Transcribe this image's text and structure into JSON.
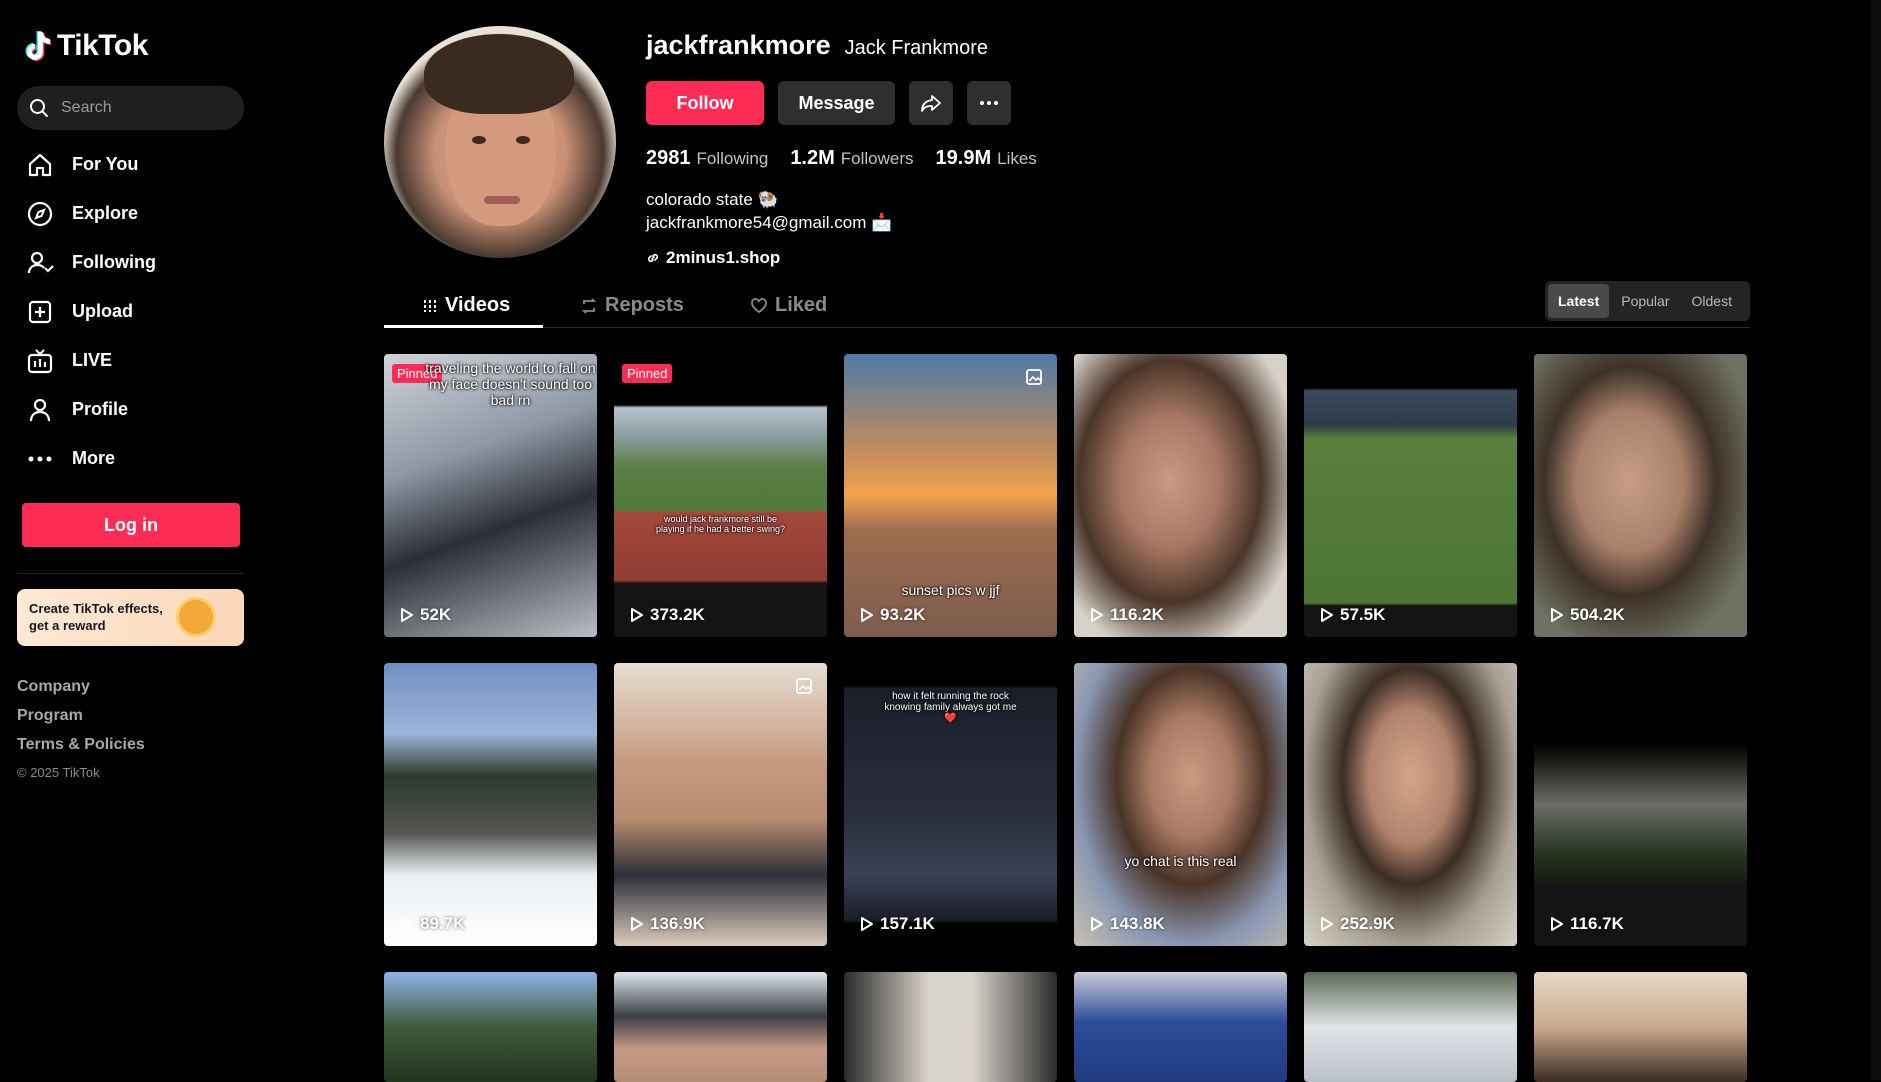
{
  "sidebar": {
    "logo": "TikTok",
    "search_placeholder": "Search",
    "nav": [
      {
        "label": "For You",
        "icon": "home-icon"
      },
      {
        "label": "Explore",
        "icon": "compass-icon"
      },
      {
        "label": "Following",
        "icon": "following-icon"
      },
      {
        "label": "Upload",
        "icon": "upload-icon"
      },
      {
        "label": "LIVE",
        "icon": "live-icon"
      },
      {
        "label": "Profile",
        "icon": "profile-icon"
      },
      {
        "label": "More",
        "icon": "more-icon"
      }
    ],
    "login_label": "Log in",
    "effects_banner": {
      "line1": "Create TikTok effects,",
      "line2": "get a reward"
    },
    "footer": {
      "company": "Company",
      "program": "Program",
      "terms": "Terms & Policies",
      "copyright": "© 2025 TikTok"
    }
  },
  "profile": {
    "username": "jackfrankmore",
    "nickname": "Jack Frankmore",
    "follow_label": "Follow",
    "message_label": "Message",
    "stats": {
      "following_count": "2981",
      "following_label": "Following",
      "followers_count": "1.2M",
      "followers_label": "Followers",
      "likes_count": "19.9M",
      "likes_label": "Likes"
    },
    "bio_line1": "colorado state 🐏",
    "bio_line2": "jackfrankmore54@gmail.com 📩",
    "link": "2minus1.shop"
  },
  "tabs": {
    "videos": "Videos",
    "reposts": "Reposts",
    "liked": "Liked",
    "sort": [
      "Latest",
      "Popular",
      "Oldest"
    ],
    "sort_selected": "Latest"
  },
  "videos": [
    {
      "views": "52K",
      "pinned": "Pinned",
      "caption": "traveling the world to fall on my face doesn't sound too bad rn"
    },
    {
      "views": "373.2K",
      "pinned": "Pinned",
      "caption": "would jack frankmore still be playing if he had a better swing?"
    },
    {
      "views": "93.2K",
      "caption": "sunset pics w jjf"
    },
    {
      "views": "116.2K"
    },
    {
      "views": "57.5K"
    },
    {
      "views": "504.2K"
    },
    {
      "views": "89.7K"
    },
    {
      "views": "136.9K"
    },
    {
      "views": "157.1K",
      "caption": "how it felt running the rock knowing family always got me ❤️"
    },
    {
      "views": "143.8K",
      "caption": "yo chat is this real"
    },
    {
      "views": "252.9K"
    },
    {
      "views": "116.7K"
    }
  ],
  "colors": {
    "accent": "#fe2c55",
    "bg": "#000000",
    "button_dark": "#2f2f2f"
  }
}
